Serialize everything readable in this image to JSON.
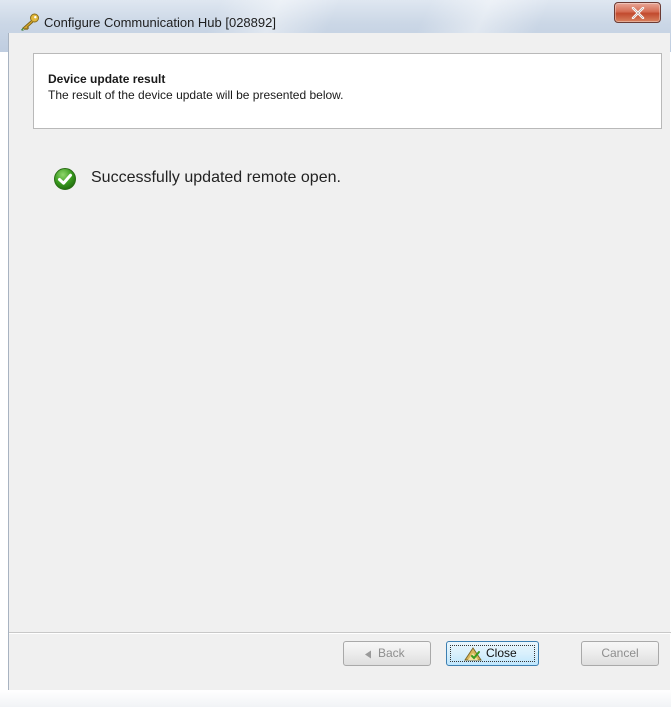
{
  "window": {
    "title": "Configure Communication Hub [028892]",
    "close_glyph": "X",
    "title_icon": "key-icon"
  },
  "header": {
    "title": "Device update result",
    "subtitle": "The result of the device update will be presented below."
  },
  "result": {
    "icon": "check-circle-icon",
    "message": "Successfully updated remote open.",
    "status_color": "#3a9b1f"
  },
  "buttons": {
    "back_label": "Back",
    "close_label": "Close",
    "cancel_label": "Cancel"
  },
  "colors": {
    "accent": "#3c7fb1",
    "panel_bg": "#f0f0f0"
  }
}
